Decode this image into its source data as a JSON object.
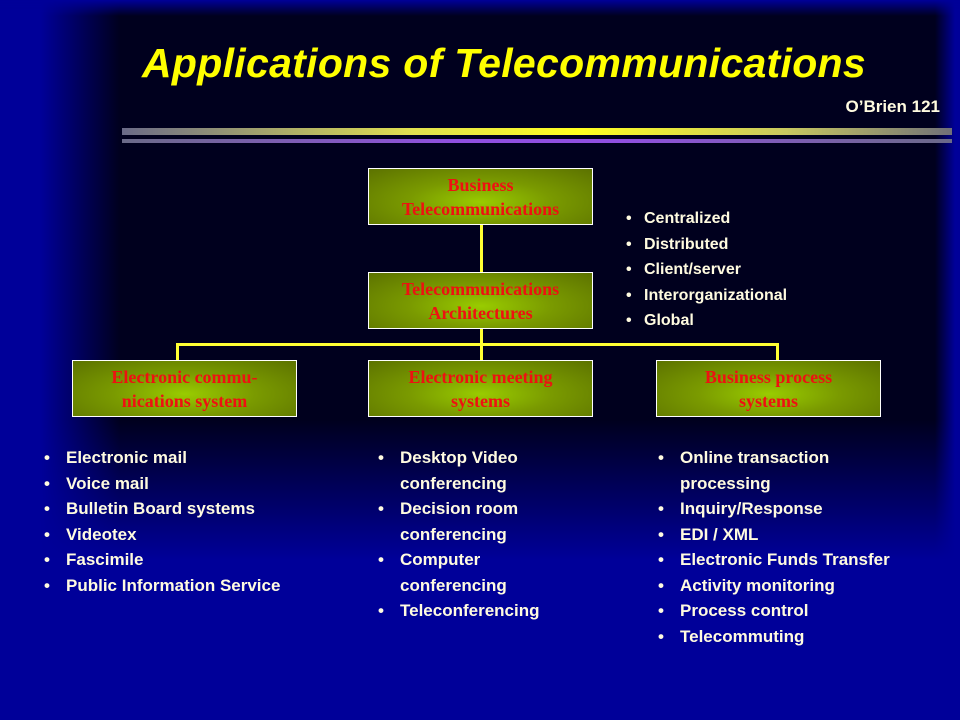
{
  "slide": {
    "title": "Applications of Telecommunications",
    "citation": "O’Brien 121",
    "colors": {
      "title": "#ffff00",
      "node_text": "#ee1111",
      "node_fill": "#99cc00",
      "connector": "#ffff33",
      "body_text": "#fffbe0",
      "background": "#000099"
    }
  },
  "diagram": {
    "root": {
      "line1": "Business",
      "line2": "Telecommunications"
    },
    "architectures": {
      "line1": "Telecommunications",
      "line2": "Architectures"
    },
    "architecture_types": [
      "Centralized",
      "Distributed",
      "Client/server",
      "Interorganizational",
      "Global"
    ],
    "branches": [
      {
        "line1": "Electronic commu-",
        "line2": "nications system",
        "items": [
          "Electronic mail",
          "Voice mail",
          "Bulletin Board systems",
          "Videotex",
          "Fascimile",
          "Public Information Service"
        ]
      },
      {
        "line1": "Electronic meeting",
        "line2": "systems",
        "items": [
          "Desktop Video conferencing",
          "Decision room conferencing",
          "Computer conferencing",
          "Teleconferencing"
        ]
      },
      {
        "line1": "Business process",
        "line2": "systems",
        "items": [
          "Online transaction processing",
          "Inquiry/Response",
          "EDI / XML",
          "Electronic Funds Transfer",
          "Activity monitoring",
          "Process control",
          "Telecommuting"
        ]
      }
    ]
  }
}
